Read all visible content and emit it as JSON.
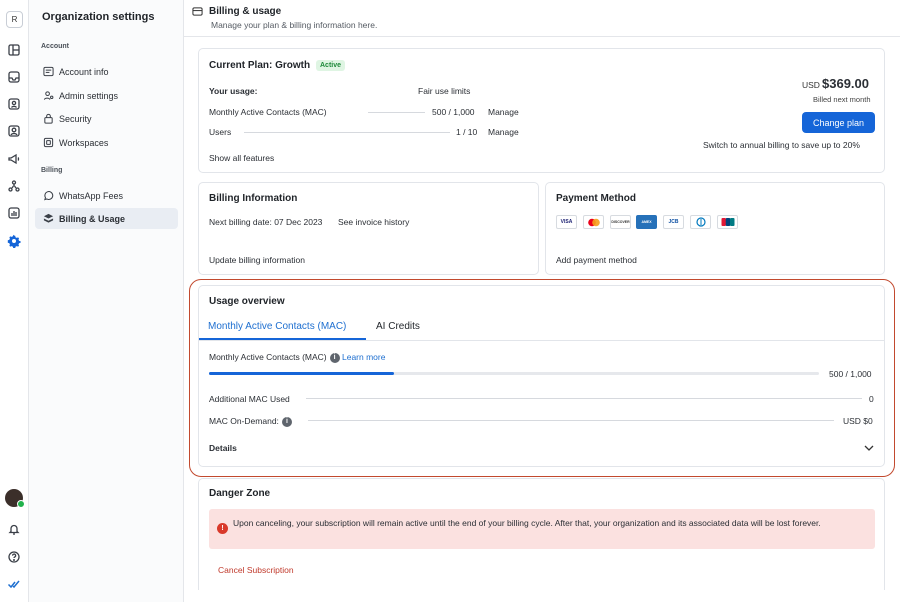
{
  "rail": {
    "workspace_initial": "R"
  },
  "sidebar": {
    "title": "Organization settings",
    "sections": [
      {
        "label": "Account"
      },
      {
        "label": "Billing"
      }
    ],
    "items": [
      {
        "label": "Account info",
        "icon": "account-info-icon"
      },
      {
        "label": "Admin settings",
        "icon": "admin-settings-icon"
      },
      {
        "label": "Security",
        "icon": "lock-icon"
      },
      {
        "label": "Workspaces",
        "icon": "workspaces-icon"
      },
      {
        "label": "WhatsApp Fees",
        "icon": "whatsapp-icon"
      },
      {
        "label": "Billing & Usage",
        "icon": "billing-icon",
        "active": true
      }
    ]
  },
  "header": {
    "title": "Billing & usage",
    "subtitle": "Manage your plan & billing information here."
  },
  "plan": {
    "title": "Current Plan: Growth",
    "status": "Active",
    "your_usage_label": "Your usage:",
    "fair_use_link": "Fair use limits",
    "rows": [
      {
        "label": "Monthly Active Contacts (MAC)",
        "value": "500 / 1,000",
        "action": "Manage"
      },
      {
        "label": "Users",
        "value": "1 / 10",
        "action": "Manage"
      }
    ],
    "show_all": "Show all features",
    "currency": "USD",
    "price": "$369.00",
    "billed_note": "Billed next month",
    "change_plan": "Change plan",
    "annual_link": "Switch to annual billing to save up to 20%"
  },
  "billing_info": {
    "title": "Billing Information",
    "next_date": "Next billing date: 07 Dec 2023",
    "invoice_link": "See invoice history",
    "update_link": "Update billing information"
  },
  "payment": {
    "title": "Payment Method",
    "methods": [
      "VISA",
      "MC",
      "DISCOVER",
      "AMEX",
      "JCB",
      "DINERS",
      "UNIONPAY"
    ],
    "add_link": "Add payment method"
  },
  "usage": {
    "title": "Usage overview",
    "tabs": [
      {
        "label": "Monthly Active Contacts (MAC)",
        "active": true
      },
      {
        "label": "AI Credits",
        "active": false
      }
    ],
    "mac_label": "Monthly Active Contacts (MAC)",
    "learn_more": "Learn more",
    "mac_value": "500 / 1,000",
    "mac_fraction": 0.5,
    "additional_label": "Additional MAC Used",
    "additional_value": "0",
    "ondemand_label": "MAC On-Demand:",
    "ondemand_value": "USD $0",
    "details": "Details"
  },
  "danger": {
    "title": "Danger Zone",
    "message": "Upon canceling, your subscription will remain active until the end of your billing cycle. After that, your organization and its associated data will be lost forever.",
    "cancel": "Cancel Subscription"
  },
  "colors": {
    "accent": "#1565d8",
    "danger": "#d9392b",
    "highlight": "#c2492e"
  }
}
